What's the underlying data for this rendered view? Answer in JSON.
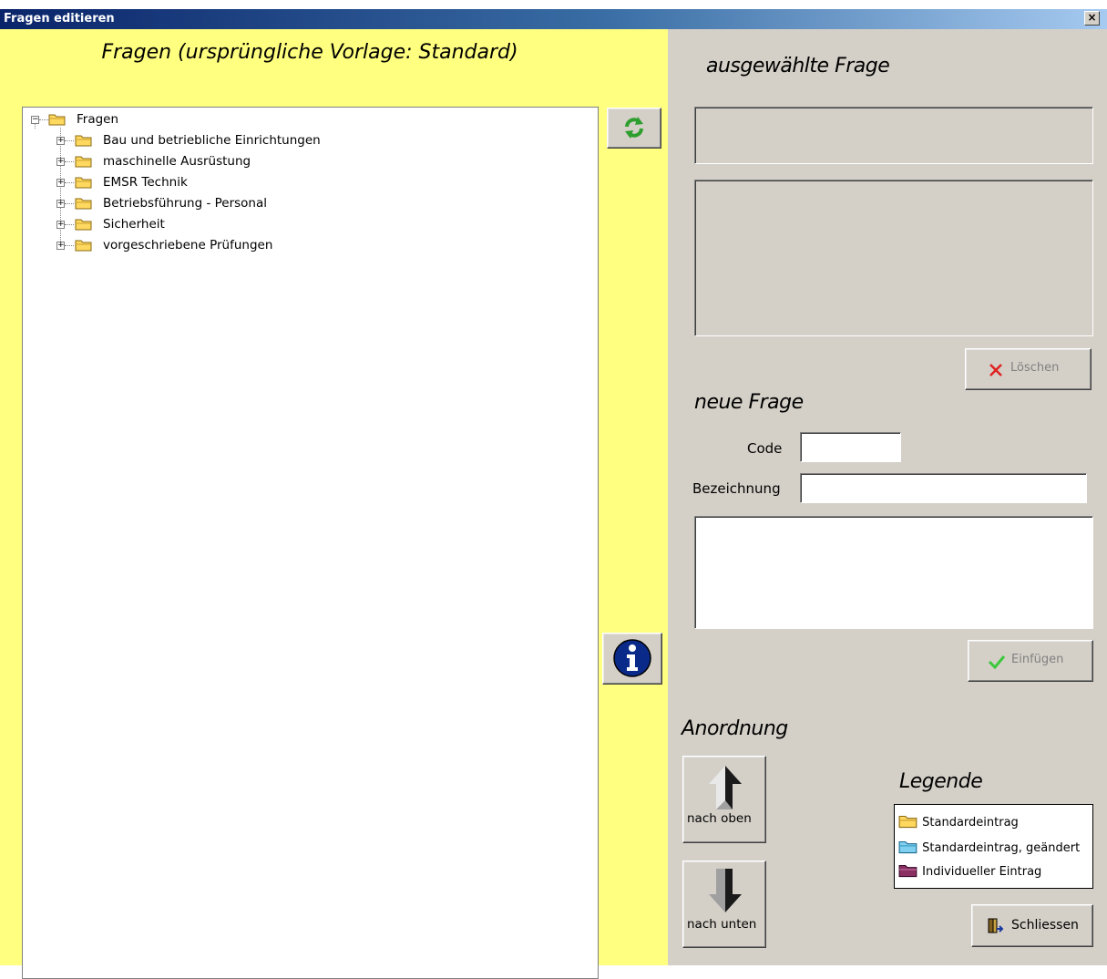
{
  "window": {
    "title": "Fragen editieren",
    "close_label": "×"
  },
  "left_panel": {
    "heading": "Fragen (ursprüngliche Vorlage: Standard)",
    "tree": {
      "root": {
        "label": "Fragen",
        "expander": "−",
        "icon": "folder-open-icon"
      },
      "children": [
        {
          "label": "Bau  und betriebliche Einrichtungen",
          "expander": "+",
          "icon": "folder-icon"
        },
        {
          "label": "maschinelle Ausrüstung",
          "expander": "+",
          "icon": "folder-icon"
        },
        {
          "label": "EMSR Technik",
          "expander": "+",
          "icon": "folder-icon"
        },
        {
          "label": "Betriebsführung - Personal",
          "expander": "+",
          "icon": "folder-icon"
        },
        {
          "label": "Sicherheit",
          "expander": "+",
          "icon": "folder-icon"
        },
        {
          "label": "vorgeschriebene Prüfungen",
          "expander": "+",
          "icon": "folder-icon"
        }
      ]
    },
    "refresh_icon": "refresh-icon",
    "info_icon": "info-icon"
  },
  "selected": {
    "heading": "ausgewählte Frage",
    "title_value": "",
    "text_value": "",
    "delete_label": "Löschen"
  },
  "new_question": {
    "heading": "neue Frage",
    "code_label": "Code",
    "code_value": "",
    "name_label": "Bezeichnung",
    "name_value": "",
    "text_value": "",
    "insert_label": "Einfügen"
  },
  "order": {
    "heading": "Anordnung",
    "up_label": "nach oben",
    "down_label": "nach unten"
  },
  "legend": {
    "heading": "Legende",
    "items": [
      {
        "label": "Standardeintrag",
        "color": "#ffd860"
      },
      {
        "label": "Standardeintrag, geändert",
        "color": "#7fd0f0"
      },
      {
        "label": "Individueller Eintrag",
        "color": "#8b2f63"
      }
    ]
  },
  "close_button": {
    "label": "Schliessen"
  },
  "colors": {
    "left_bg": "#ffff80",
    "right_bg": "#d4d0c8",
    "title_start": "#0a246a",
    "title_end": "#a6caf0"
  }
}
